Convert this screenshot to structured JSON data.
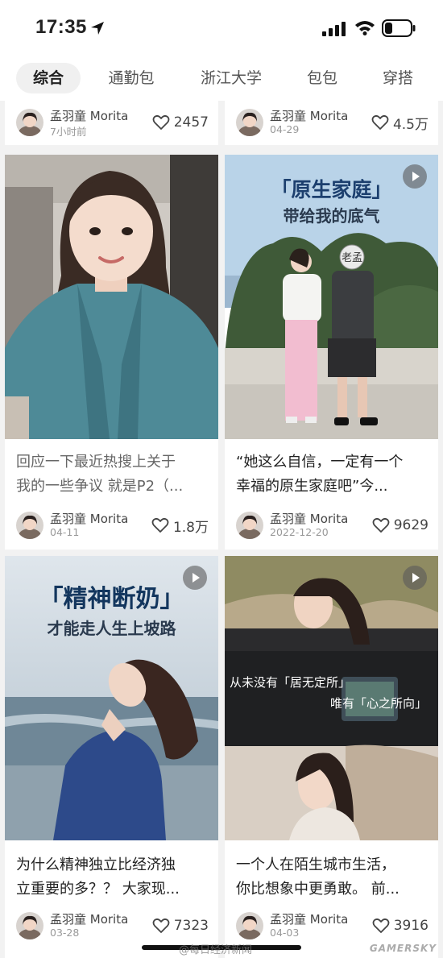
{
  "status": {
    "time": "17:35",
    "icons": [
      "location-arrow-icon",
      "cellular-signal-icon",
      "wifi-icon",
      "battery-icon"
    ]
  },
  "tabs": [
    {
      "label": "综合",
      "active": true
    },
    {
      "label": "通勤包",
      "active": false
    },
    {
      "label": "浙江大学",
      "active": false
    },
    {
      "label": "包包",
      "active": false
    },
    {
      "label": "穿搭",
      "active": false
    }
  ],
  "cards": [
    {
      "author": "孟羽童 Morita",
      "date": "7小时前",
      "likes": "2457"
    },
    {
      "author": "孟羽童 Morita",
      "date": "04-29",
      "likes": "4.5万"
    },
    {
      "author": "孟羽童 Morita",
      "date": "04-11",
      "likes": "1.8万",
      "title_line1": "回应一下最近热搜上关于",
      "title_line2": "我的一些争议 就是P2（..."
    },
    {
      "author": "孟羽童 Morita",
      "date": "2022-12-20",
      "likes": "9629",
      "title_line1": "“她这么自信，一定有一个",
      "title_line2": "幸福的原生家庭吧”今...",
      "overlay_line1": "「原生家庭」",
      "overlay_line2": "带给我的底气",
      "mask_text": "老孟"
    },
    {
      "author": "孟羽童 Morita",
      "date": "03-28",
      "likes": "7323",
      "title_line1": "为什么精神独立比经济独",
      "title_line2": "立重要的多？？ 大家现...",
      "overlay_line1": "「精神断奶」",
      "overlay_line2": "才能走人生上坡路"
    },
    {
      "author": "孟羽童 Morita",
      "date": "04-03",
      "likes": "3916",
      "title_line1": "一个人在陌生城市生活，",
      "title_line2": "你比想象中更勇敢。 前...",
      "overlay_line1": "从未没有「居无定所」",
      "overlay_line2": "唯有「心之所向」"
    }
  ],
  "watermark": "@每日经济新闻",
  "brand": "GAMERSKY",
  "colors": {
    "background": "#f2f2f2",
    "card": "#ffffff",
    "tab_active_bg": "#f0f0f0",
    "text_primary": "#222222",
    "text_secondary": "#999999"
  }
}
